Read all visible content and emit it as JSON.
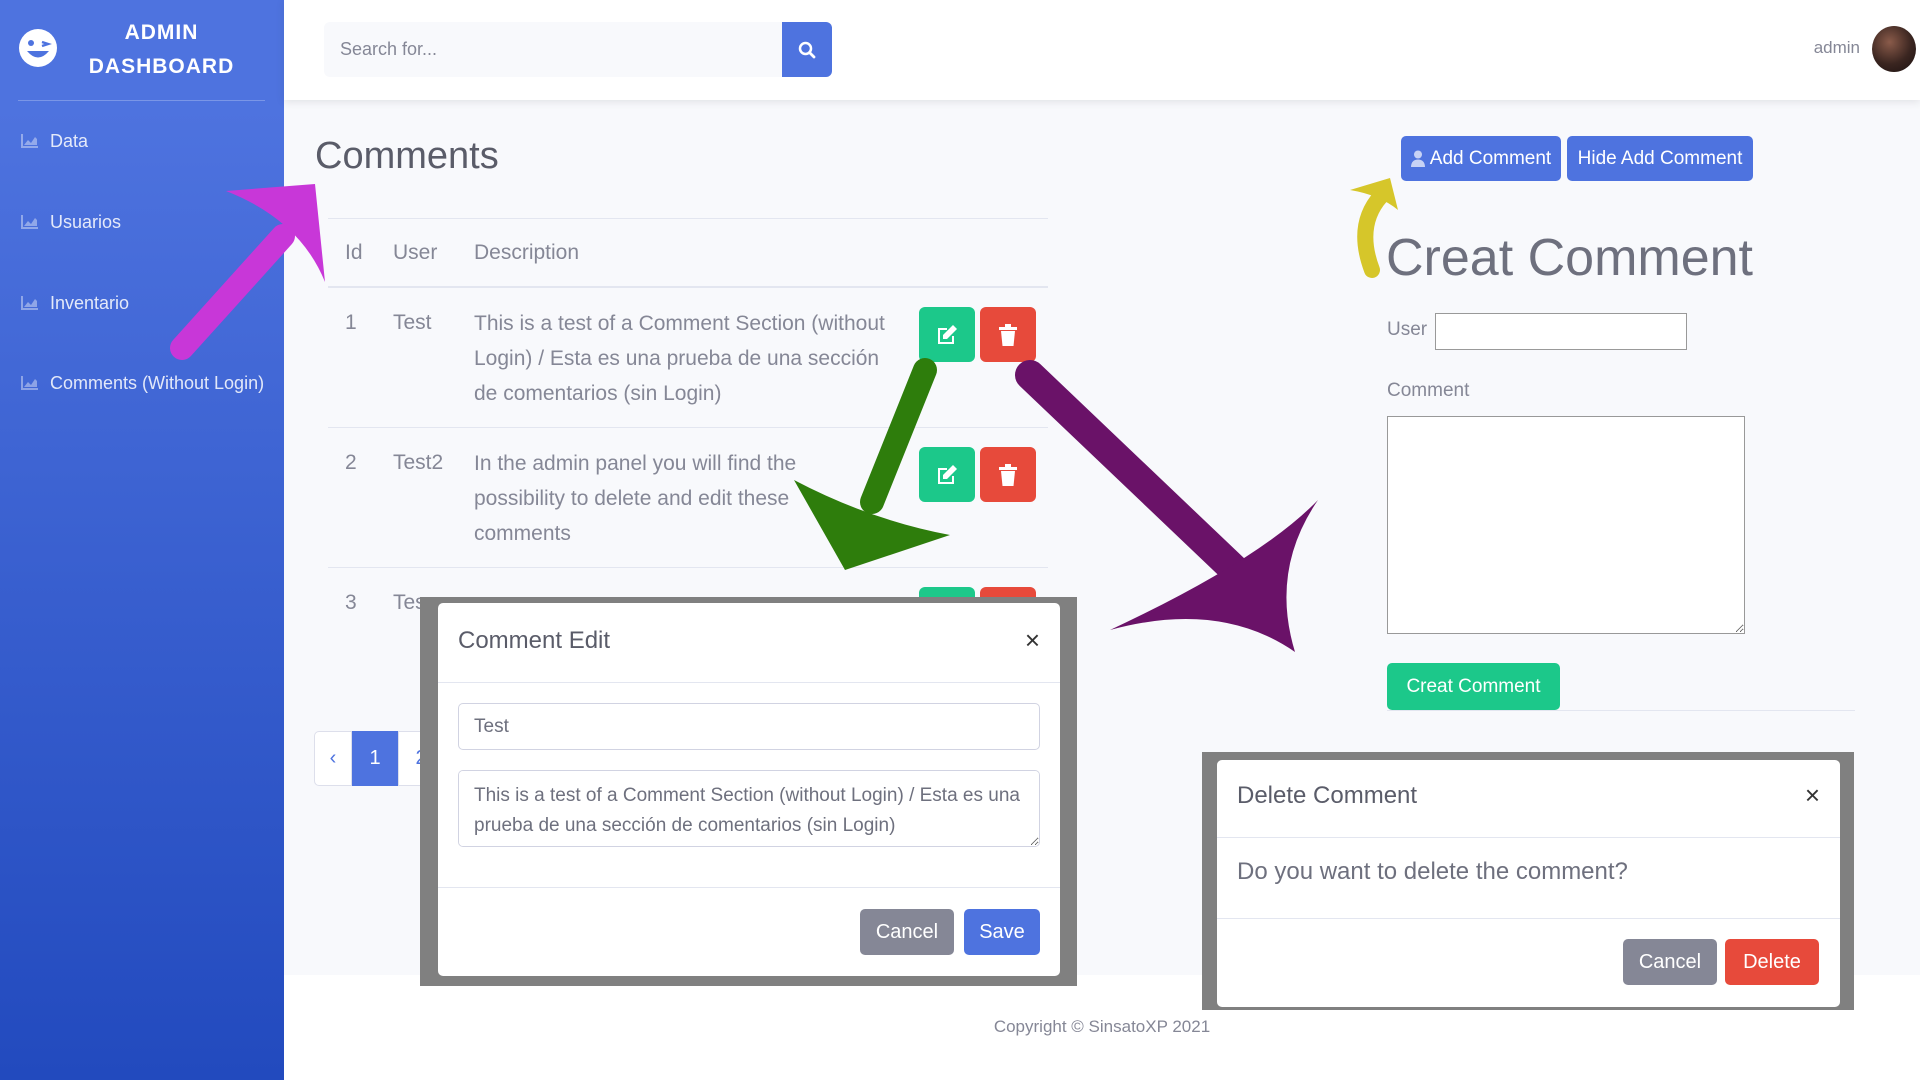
{
  "sidebar": {
    "brand_line1": "ADMIN",
    "brand_line2": "DASHBOARD",
    "items": [
      {
        "label": "Data"
      },
      {
        "label": "Usuarios"
      },
      {
        "label": "Inventario"
      },
      {
        "label": "Comments (Without Login)"
      }
    ]
  },
  "topbar": {
    "search_placeholder": "Search for...",
    "user_name": "admin"
  },
  "main": {
    "title": "Comments",
    "columns": [
      "Id",
      "User",
      "Description"
    ],
    "rows": [
      {
        "id": "1",
        "user": "Test",
        "description": "This is a test of a Comment Section (without Login) / Esta es una prueba de una sección de comentarios (sin Login)"
      },
      {
        "id": "2",
        "user": "Test2",
        "description": "In the admin panel you will find the possibility to delete and edit these comments"
      },
      {
        "id": "3",
        "user": "Tes",
        "description": ""
      }
    ],
    "pagination": {
      "prev": "‹",
      "pages": [
        "1",
        "2"
      ]
    }
  },
  "right": {
    "add_comment_label": "Add Comment",
    "hide_add_comment_label": "Hide Add Comment",
    "create_title": "Creat Comment",
    "user_label": "User",
    "comment_label": "Comment",
    "create_button_label": "Creat Comment"
  },
  "edit_modal": {
    "title": "Comment Edit",
    "close": "×",
    "user_value": "Test",
    "comment_value": "This is a test of a Comment Section (without Login) / Esta es una prueba de una sección de comentarios (sin Login)",
    "cancel_label": "Cancel",
    "save_label": "Save"
  },
  "delete_modal": {
    "title": "Delete Comment",
    "close": "×",
    "message": "Do you want to delete the comment?",
    "cancel_label": "Cancel",
    "delete_label": "Delete"
  },
  "footer": {
    "copyright": "Copyright © SinsatoXP 2021"
  },
  "colors": {
    "primary": "#4e73df",
    "success": "#1cc88a",
    "danger": "#e74a3b",
    "secondary": "#858796",
    "arrow_magenta": "#c837d8",
    "arrow_green": "#2e7d0c",
    "arrow_purple": "#6a1268",
    "arrow_yellow": "#d6c62a"
  }
}
